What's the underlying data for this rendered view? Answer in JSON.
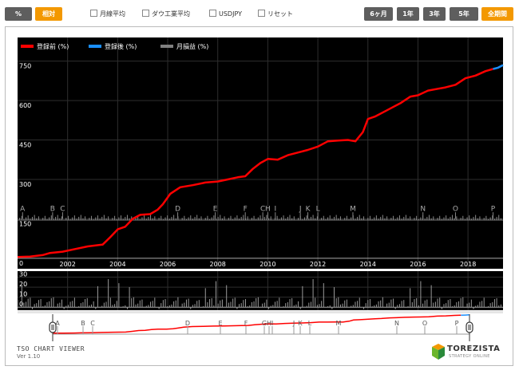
{
  "toolbar": {
    "mode_buttons": [
      {
        "label": "%",
        "style": "gray"
      },
      {
        "label": "相対",
        "style": "orange"
      }
    ],
    "checkboxes": [
      "月線平均",
      "ダウ工業平均",
      "USDJPY",
      "リセット"
    ],
    "period_buttons": [
      {
        "label": "6ヶ月",
        "style": "gray"
      },
      {
        "label": "1年",
        "style": "gray"
      },
      {
        "label": "3年",
        "style": "gray"
      },
      {
        "label": "5年",
        "style": "gray"
      },
      {
        "label": "全期間",
        "style": "orange"
      }
    ]
  },
  "chart_data": {
    "type": "line",
    "legend": [
      {
        "name": "登録前 (%)",
        "color": "#ff0000"
      },
      {
        "name": "登録後 (%)",
        "color": "#1a8fff"
      },
      {
        "name": "月損益 (%)",
        "color": "#808080"
      }
    ],
    "y_ticks": [
      0,
      150,
      300,
      450,
      600,
      750
    ],
    "ylim": [
      -40,
      840
    ],
    "x_year_ticks": [
      "2002",
      "2004",
      "2006",
      "2008",
      "2010",
      "2012",
      "2014",
      "2016",
      "2018"
    ],
    "xlim": [
      2000.0,
      2019.4
    ],
    "series_before": [
      [
        2000.0,
        5
      ],
      [
        2000.5,
        6
      ],
      [
        2001.0,
        12
      ],
      [
        2001.3,
        20
      ],
      [
        2001.8,
        25
      ],
      [
        2002.3,
        35
      ],
      [
        2002.8,
        45
      ],
      [
        2003.4,
        52
      ],
      [
        2003.7,
        80
      ],
      [
        2004.0,
        110
      ],
      [
        2004.3,
        120
      ],
      [
        2004.6,
        150
      ],
      [
        2004.9,
        165
      ],
      [
        2005.3,
        168
      ],
      [
        2005.6,
        185
      ],
      [
        2005.8,
        205
      ],
      [
        2006.1,
        245
      ],
      [
        2006.5,
        270
      ],
      [
        2007.0,
        278
      ],
      [
        2007.5,
        288
      ],
      [
        2008.0,
        292
      ],
      [
        2008.4,
        300
      ],
      [
        2008.8,
        308
      ],
      [
        2009.1,
        312
      ],
      [
        2009.4,
        340
      ],
      [
        2009.7,
        362
      ],
      [
        2010.0,
        378
      ],
      [
        2010.4,
        375
      ],
      [
        2010.8,
        392
      ],
      [
        2011.2,
        402
      ],
      [
        2011.6,
        412
      ],
      [
        2012.0,
        425
      ],
      [
        2012.4,
        445
      ],
      [
        2012.8,
        448
      ],
      [
        2013.2,
        450
      ],
      [
        2013.5,
        445
      ],
      [
        2013.8,
        480
      ],
      [
        2014.0,
        530
      ],
      [
        2014.3,
        540
      ],
      [
        2014.7,
        560
      ],
      [
        2015.0,
        575
      ],
      [
        2015.3,
        590
      ],
      [
        2015.7,
        615
      ],
      [
        2016.0,
        620
      ],
      [
        2016.4,
        638
      ],
      [
        2016.8,
        645
      ],
      [
        2017.1,
        650
      ],
      [
        2017.5,
        660
      ],
      [
        2017.9,
        685
      ],
      [
        2018.3,
        695
      ],
      [
        2018.7,
        712
      ],
      [
        2019.0,
        720
      ]
    ],
    "series_after": [
      [
        2019.0,
        720
      ],
      [
        2019.2,
        725
      ],
      [
        2019.4,
        735
      ]
    ],
    "events": [
      {
        "label": "A",
        "x": 2000.2
      },
      {
        "label": "B",
        "x": 2001.4
      },
      {
        "label": "C",
        "x": 2001.8
      },
      {
        "label": "D",
        "x": 2006.4
      },
      {
        "label": "E",
        "x": 2007.9
      },
      {
        "label": "F",
        "x": 2009.1
      },
      {
        "label": "C",
        "x": 2009.8
      },
      {
        "label": "H",
        "x": 2010.0
      },
      {
        "label": "I",
        "x": 2010.3
      },
      {
        "label": "J",
        "x": 2011.3
      },
      {
        "label": "K",
        "x": 2011.6
      },
      {
        "label": "L",
        "x": 2012.0
      },
      {
        "label": "M",
        "x": 2013.4
      },
      {
        "label": "N",
        "x": 2016.2
      },
      {
        "label": "O",
        "x": 2017.5
      },
      {
        "label": "P",
        "x": 2019.0
      }
    ],
    "monthly_ticks": [
      0,
      10,
      20,
      30
    ],
    "monthly_ylim": [
      -3,
      36
    ],
    "navigator_events": [
      "A",
      "B",
      "C",
      "D",
      "E",
      "F",
      "G",
      "H",
      "I",
      "J",
      "K",
      "L",
      "M",
      "N",
      "O",
      "P"
    ]
  },
  "footer": {
    "title": "TSO CHART VIEWER",
    "version": "Ver 1.10"
  },
  "logo": {
    "name": "TOREZISTA",
    "tagline": "STRATEGY ONLINE"
  }
}
